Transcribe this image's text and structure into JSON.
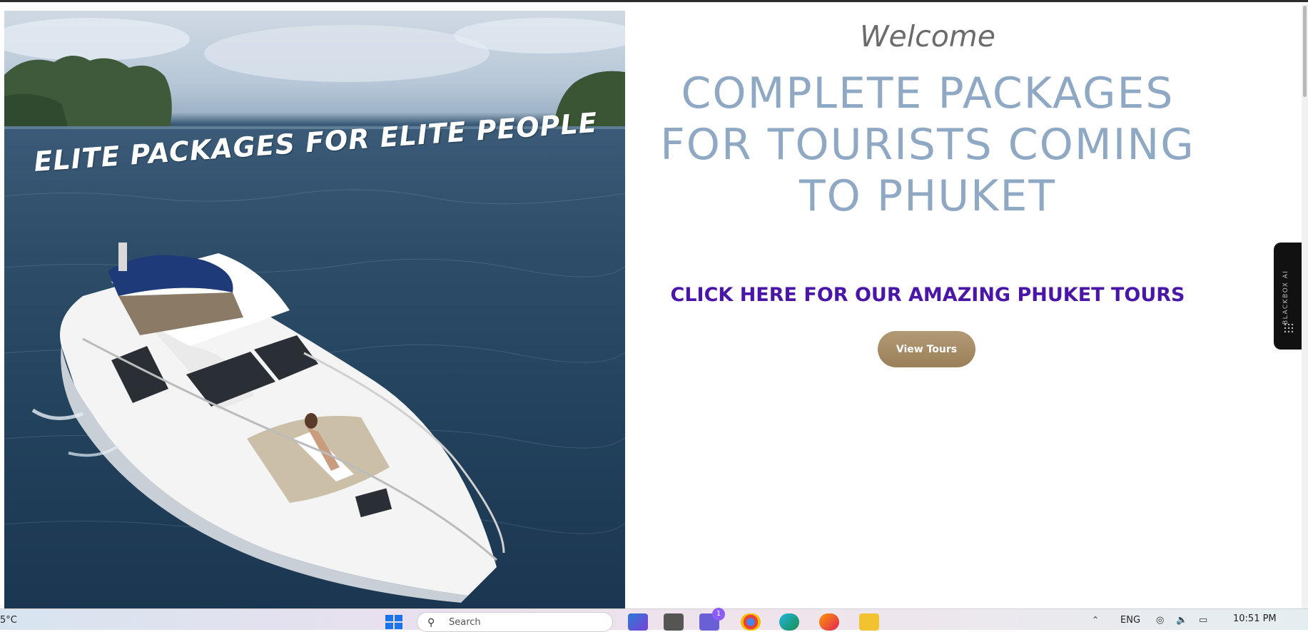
{
  "hero": {
    "caption": "ELITE PACKAGES FOR ELITE PEOPLE"
  },
  "main": {
    "welcome": "Welcome",
    "headline": "COMPLETE PACKAGES FOR TOURISTS COMING TO PHUKET",
    "cta_link": "CLICK HERE FOR OUR AMAZING PHUKET TOURS",
    "view_tours_label": "View Tours"
  },
  "widget": {
    "label": "BLACKBOX AI"
  },
  "taskbar": {
    "weather": "5°C",
    "search_placeholder": "Search",
    "notification_count": "1",
    "language": "ENG",
    "time": "10:51 PM"
  },
  "colors": {
    "headline": "#8fa8c3",
    "cta_link": "#4a16a8",
    "button": "#a88f68"
  }
}
